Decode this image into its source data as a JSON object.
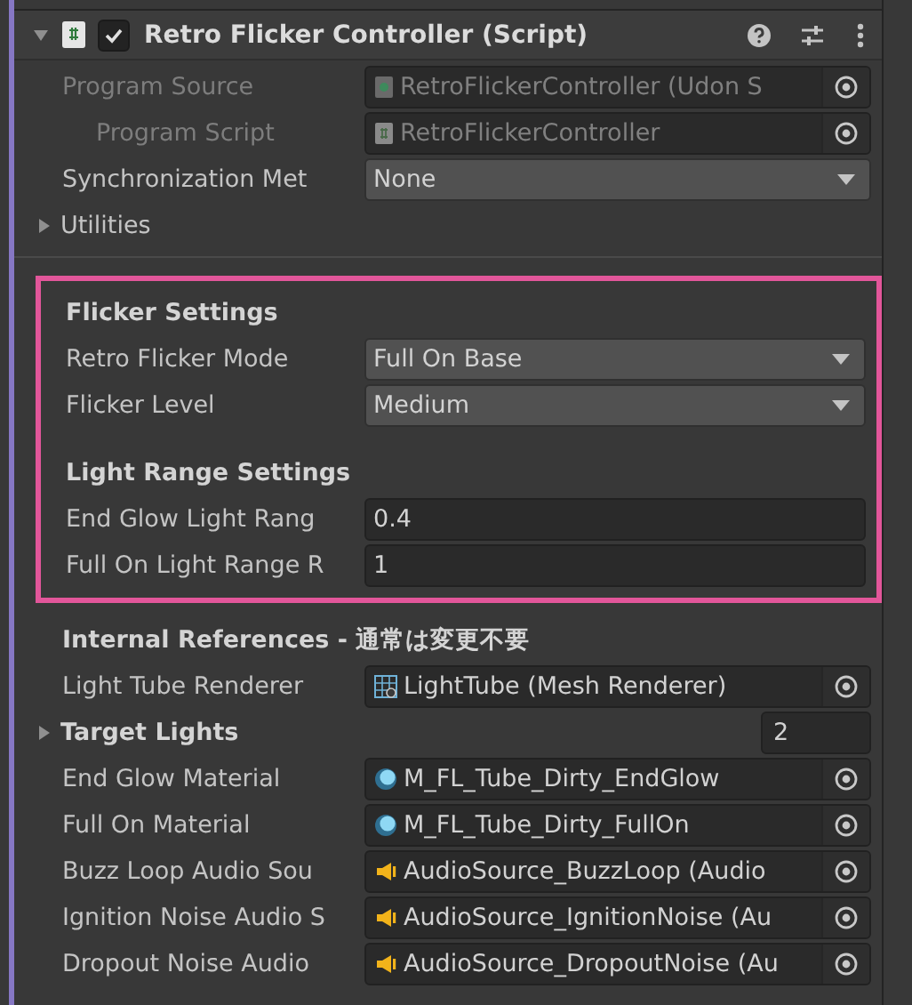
{
  "component": {
    "title": "Retro Flicker Controller (Script)",
    "expanded": true,
    "enabled": true
  },
  "groups": [
    {
      "highlighted": false,
      "rows": [
        {
          "kind": "udon_ref",
          "label": "Program Source",
          "value": "RetroFlickerController (Udon S",
          "disabled": true,
          "indented": false
        },
        {
          "kind": "script_ref",
          "label": "Program Script",
          "value": "RetroFlickerController",
          "disabled": true,
          "indented": true
        },
        {
          "kind": "dropdown",
          "label": "Synchronization Met",
          "value": "None"
        },
        {
          "kind": "foldout",
          "label": "Utilities",
          "expanded": false
        }
      ]
    },
    {
      "highlighted": true,
      "rows": [
        {
          "kind": "header",
          "label": "Flicker Settings"
        },
        {
          "kind": "dropdown",
          "label": "Retro Flicker Mode",
          "value": "Full On Base"
        },
        {
          "kind": "dropdown",
          "label": "Flicker Level",
          "value": "Medium"
        },
        {
          "kind": "spacer"
        },
        {
          "kind": "header",
          "label": "Light Range Settings"
        },
        {
          "kind": "number",
          "label": "End Glow Light Rang",
          "value": "0.4"
        },
        {
          "kind": "number",
          "label": "Full On Light Range R",
          "value": "1"
        }
      ]
    },
    {
      "highlighted": false,
      "rows": [
        {
          "kind": "header",
          "label": "Internal References - 通常は変更不要"
        },
        {
          "kind": "mesh_ref",
          "label": "Light Tube Renderer",
          "value": "LightTube (Mesh Renderer)",
          "disabled": false,
          "indented": false
        },
        {
          "kind": "array",
          "label": "Target Lights",
          "value": "2",
          "expanded": false
        },
        {
          "kind": "material_ref",
          "label": "End Glow Material",
          "value": "M_FL_Tube_Dirty_EndGlow",
          "disabled": false,
          "indented": false
        },
        {
          "kind": "material_ref",
          "label": "Full On Material",
          "value": "M_FL_Tube_Dirty_FullOn",
          "disabled": false,
          "indented": false
        },
        {
          "kind": "audio_ref",
          "label": "Buzz Loop Audio Sou",
          "value": "AudioSource_BuzzLoop (Audio",
          "disabled": false,
          "indented": false
        },
        {
          "kind": "audio_ref",
          "label": "Ignition Noise Audio S",
          "value": "AudioSource_IgnitionNoise (Au",
          "disabled": false,
          "indented": false
        },
        {
          "kind": "audio_ref",
          "label": "Dropout Noise Audio",
          "value": "AudioSource_DropoutNoise (Au",
          "disabled": false,
          "indented": false
        }
      ]
    }
  ]
}
